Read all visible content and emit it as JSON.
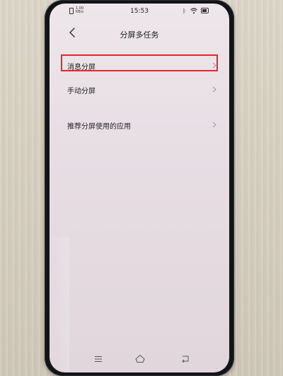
{
  "status_bar": {
    "time": "15:53",
    "net_speed_line1": "1.00",
    "net_speed_line2": "KB/s"
  },
  "header": {
    "title": "分屏多任务"
  },
  "list": {
    "items": [
      {
        "label": "消息分屏",
        "highlighted": true
      },
      {
        "label": "手动分屏",
        "highlighted": false
      },
      {
        "label": "推荐分屏使用的应用",
        "highlighted": false
      }
    ]
  },
  "colors": {
    "highlight": "#e4262b",
    "screen_bg": "#ebe3e8",
    "text": "#222222"
  },
  "icons": {
    "back": "chevron-left-icon",
    "item_arrow": "chevron-right-icon",
    "nav_menu": "menu-icon",
    "nav_home": "home-icon",
    "nav_back": "back-arrow-icon"
  }
}
